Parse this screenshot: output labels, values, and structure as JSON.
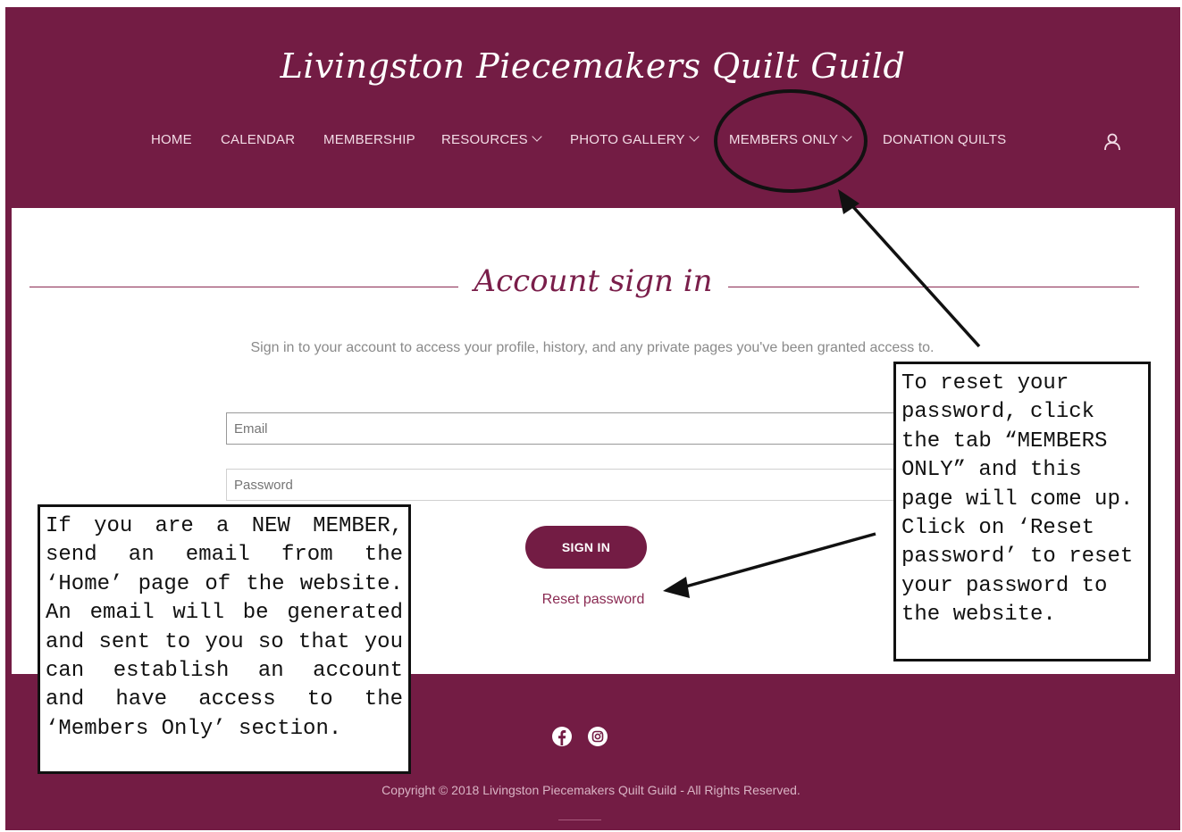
{
  "site": {
    "logo": "Livingston Piecemakers Quilt Guild"
  },
  "nav": {
    "items": [
      {
        "label": "HOME"
      },
      {
        "label": "CALENDAR"
      },
      {
        "label": "MEMBERSHIP"
      },
      {
        "label": "RESOURCES"
      },
      {
        "label": "PHOTO GALLERY"
      },
      {
        "label": "MEMBERS ONLY"
      },
      {
        "label": "DONATION QUILTS"
      }
    ],
    "account_icon": "user-icon"
  },
  "signin": {
    "title": "Account sign in",
    "intro": "Sign in to your account to access your profile, history, and any private pages you've been granted access to.",
    "email_placeholder": "Email",
    "password_placeholder": "Password",
    "button_label": "SIGN IN",
    "reset_label": "Reset password"
  },
  "footer": {
    "icons": [
      "facebook-icon",
      "instagram-icon"
    ],
    "copyright": "Copyright © 2018 Livingston Piecemakers Quilt Guild - All Rights Reserved."
  },
  "annotations": {
    "left_note": "If you are a NEW MEMBER, send an email from the ‘Home’ page of the website. An email will be generated and sent to you so that you can establish an account and have access to the ‘Members Only’ section.",
    "right_note": "To reset your password, click the tab “MEMBERS ONLY” and this page will come up. Click on ‘Reset password’ to reset your password to the website."
  },
  "colors": {
    "brand": "#731c44",
    "background": "#ffffff",
    "link": "#8a2a52"
  }
}
